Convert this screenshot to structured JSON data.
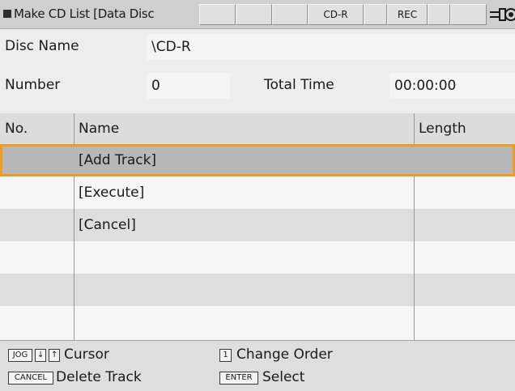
{
  "titlebar": {
    "title": "Make CD List [Data Disc",
    "media": "CD-R",
    "rec": "REC"
  },
  "info": {
    "disc_name_label": "Disc Name",
    "disc_name_value": "\\CD-R",
    "number_label": "Number",
    "number_value": "0",
    "total_time_label": "Total Time",
    "total_time_value": "00:00:00"
  },
  "table": {
    "columns": {
      "no": "No.",
      "name": "Name",
      "length": "Length"
    },
    "rows": [
      {
        "no": "",
        "name": "[Add Track]",
        "length": "",
        "selected": true
      },
      {
        "no": "",
        "name": "[Execute]",
        "length": ""
      },
      {
        "no": "",
        "name": "[Cancel]",
        "length": ""
      },
      {
        "no": "",
        "name": "",
        "length": ""
      },
      {
        "no": "",
        "name": "",
        "length": ""
      },
      {
        "no": "",
        "name": "",
        "length": ""
      }
    ]
  },
  "footer": {
    "jog_key": "JOG",
    "down_key": "↓",
    "up_key": "↑",
    "cursor_label": "Cursor",
    "one_key": "1",
    "change_order_label": "Change Order",
    "cancel_key": "CANCEL",
    "delete_track_label": "Delete Track",
    "enter_key": "ENTER",
    "select_label": "Select"
  },
  "colors": {
    "selection_border": "#f29a1e",
    "selected_row": "#b7b7b7"
  }
}
